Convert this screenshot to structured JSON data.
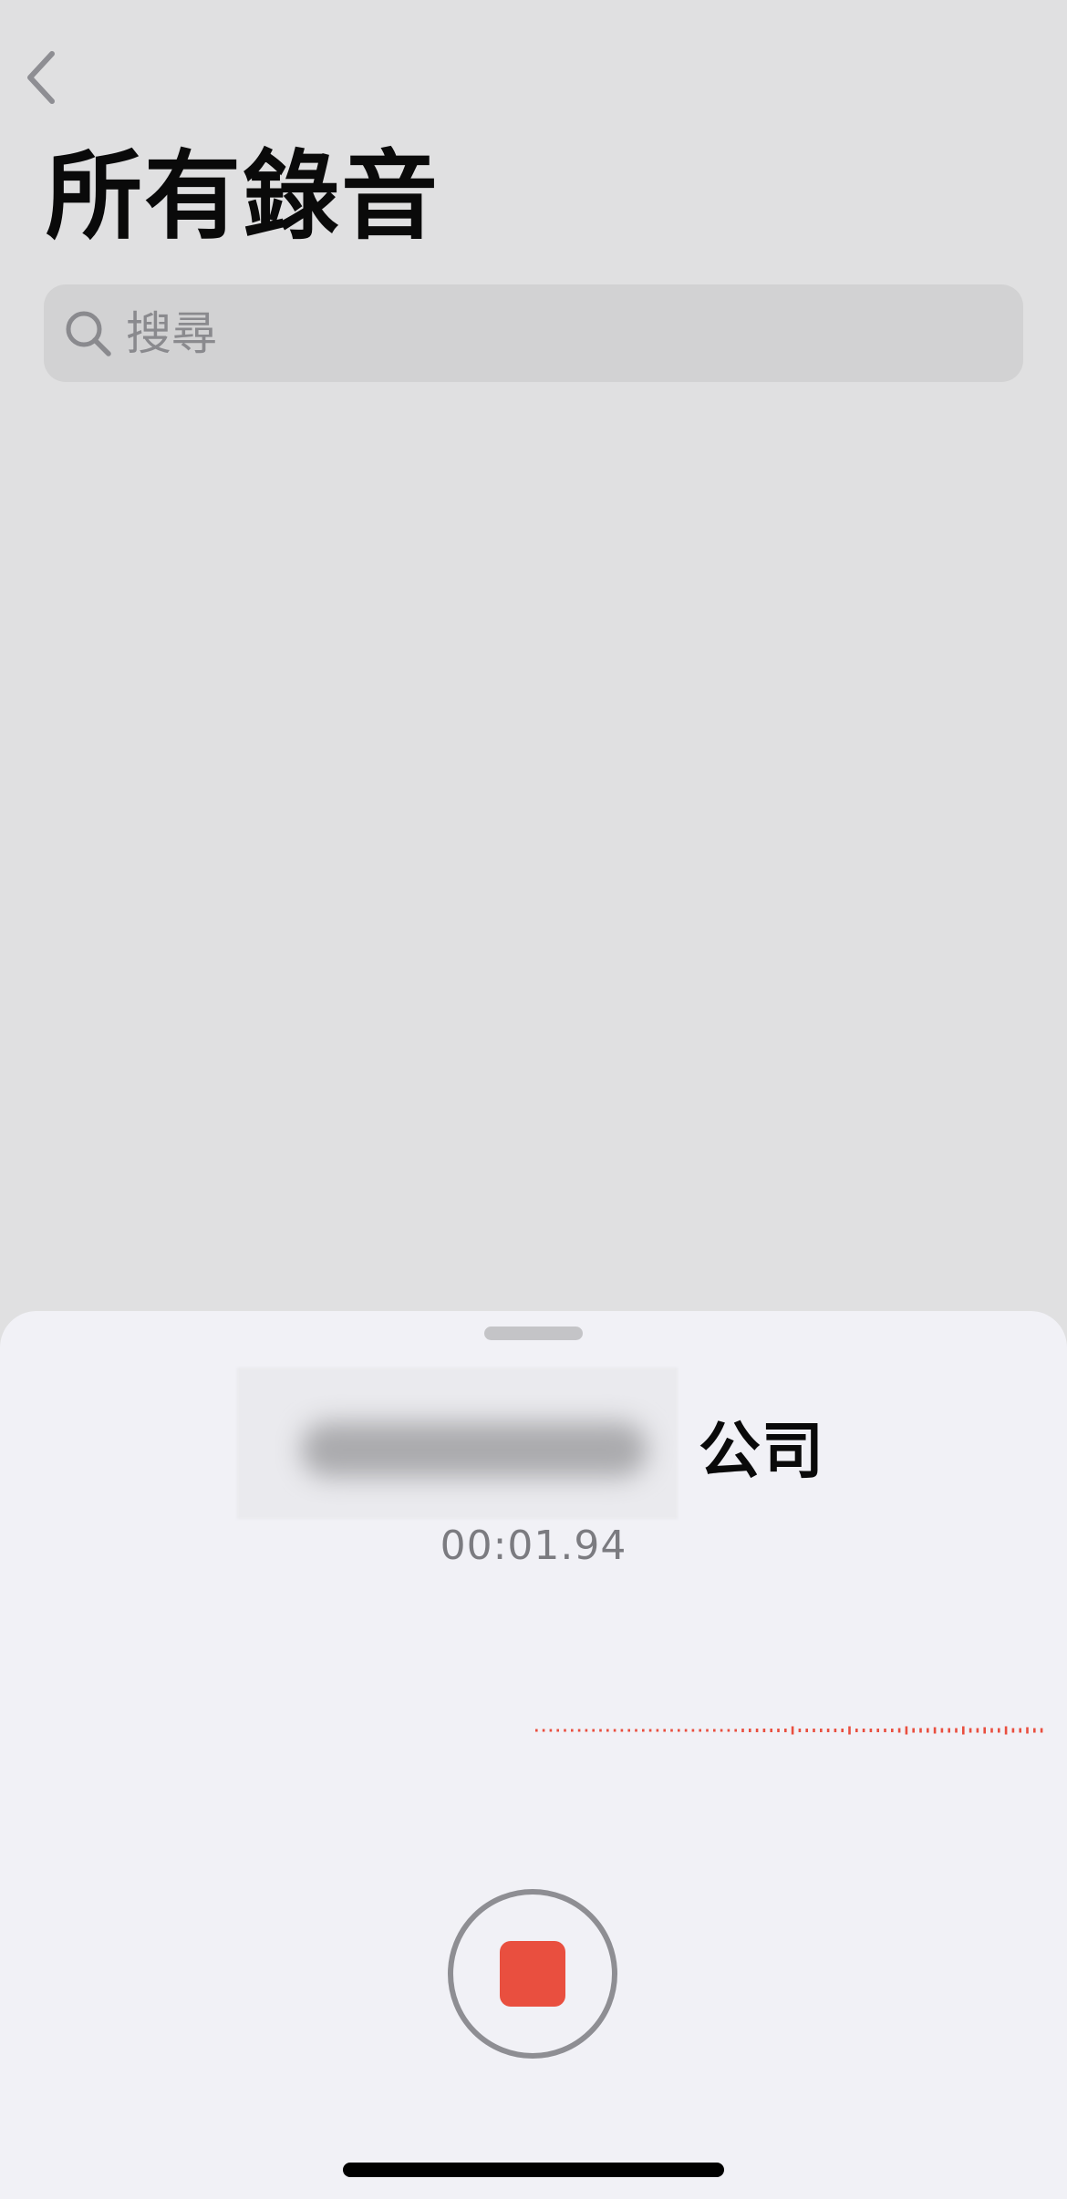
{
  "header": {
    "back_icon": "chevron-left-icon",
    "title": "所有錄音"
  },
  "search": {
    "icon": "search-icon",
    "placeholder": "搜尋"
  },
  "recording": {
    "title_visible_suffix": "公司",
    "elapsed": "00:01.94"
  },
  "controls": {
    "stop_icon": "stop-icon"
  },
  "colors": {
    "accent": "#e94f3f",
    "waveform": "#e94f3f"
  }
}
